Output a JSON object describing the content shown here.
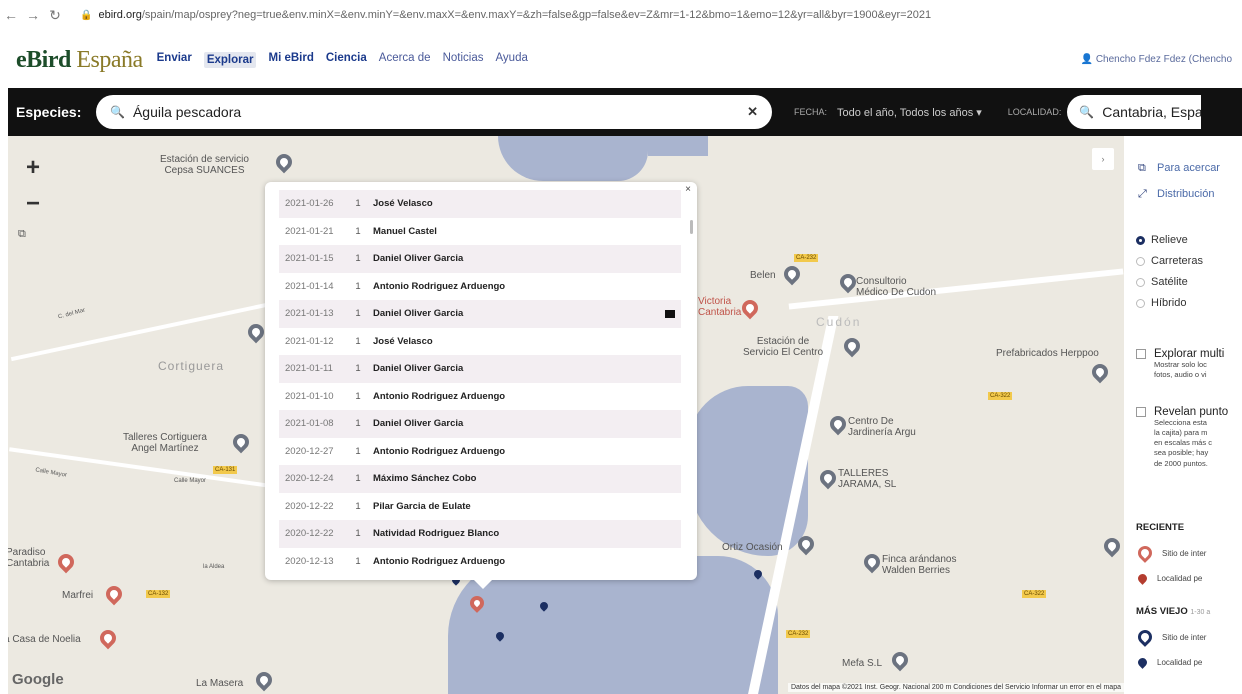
{
  "browser": {
    "url_host": "ebird.org",
    "url_rest": "/spain/map/osprey?neg=true&env.minX=&env.minY=&env.maxX=&env.maxY=&zh=false&gp=false&ev=Z&mr=1-12&bmo=1&emo=12&yr=all&byr=1900&eyr=2021"
  },
  "header": {
    "logo_main": "eBird",
    "logo_region": "España",
    "nav": [
      "Enviar",
      "Explorar",
      "Mi eBird",
      "Ciencia",
      "Acerca de",
      "Noticias",
      "Ayuda"
    ],
    "user": "Chencho Fdez Fdez (Chencho"
  },
  "search": {
    "species_label": "Especies:",
    "species_value": "Águila pescadora",
    "fecha_label": "FECHA:",
    "fecha_value": "Todo el año, Todos los años",
    "locality_label": "LOCALIDAD:",
    "locality_value": "Cantabria, Espa"
  },
  "map": {
    "zoom_in": "+",
    "zoom_out": "−",
    "google": "Google",
    "attribution": "Datos del mapa ©2021 Inst. Geogr. Nacional   200 m   Condiciones del Servicio   Informar un error en el mapa",
    "labels": {
      "cepsa": "Estación de servicio\nCepsa SUANCES",
      "cortiguera": "Cortiguera",
      "talleres_cortiguera": "Talleres Cortiguera\nAngel Martínez",
      "calle_mayor_1": "Calle Mayor",
      "calle_mayor_2": "Calle Mayor",
      "paradiso": "Paradiso\nCantabria",
      "marfrei": "Marfrei",
      "casa_noelia": "a Casa de Noelia",
      "la_masera": "La Masera",
      "belen": "Belen",
      "consultorio": "Consultorio\nMédico De Cudon",
      "victoria": "Victoria\nCantabria",
      "cudon": "Cudón",
      "estacion_centro": "Estación de\nServicio El Centro",
      "prefabricados": "Prefabricados Herppoo",
      "centro_jardineria": "Centro De\nJardinería Argu",
      "talleres_jarama": "TALLERES\nJARAMA, SL",
      "ortiz": "Ortiz Ocasión",
      "finca": "Finca arándanos\nWalden Berries",
      "mefa": "Mefa S.L",
      "c_mar": "C. del Mar",
      "la_aldea": "la Aldea"
    },
    "badges": [
      "CA-232",
      "CA-131",
      "CA-132",
      "CA-322",
      "CA-232",
      "CA-322"
    ]
  },
  "popup": {
    "close": "×",
    "rows": [
      {
        "date": "2021-01-26",
        "count": "1",
        "observer": "José Velasco"
      },
      {
        "date": "2021-01-21",
        "count": "1",
        "observer": "Manuel Castel"
      },
      {
        "date": "2021-01-15",
        "count": "1",
        "observer": "Daniel Oliver Garcia"
      },
      {
        "date": "2021-01-14",
        "count": "1",
        "observer": "Antonio Rodriguez Arduengo"
      },
      {
        "date": "2021-01-13",
        "count": "1",
        "observer": "Daniel Oliver Garcia",
        "media": true
      },
      {
        "date": "2021-01-12",
        "count": "1",
        "observer": "José Velasco"
      },
      {
        "date": "2021-01-11",
        "count": "1",
        "observer": "Daniel Oliver Garcia"
      },
      {
        "date": "2021-01-10",
        "count": "1",
        "observer": "Antonio Rodriguez Arduengo"
      },
      {
        "date": "2021-01-08",
        "count": "1",
        "observer": "Daniel Oliver Garcia"
      },
      {
        "date": "2020-12-27",
        "count": "1",
        "observer": "Antonio Rodriguez Arduengo"
      },
      {
        "date": "2020-12-24",
        "count": "1",
        "observer": "Máximo Sánchez Cobo"
      },
      {
        "date": "2020-12-22",
        "count": "1",
        "observer": "Pilar Garcia de Eulate"
      },
      {
        "date": "2020-12-22",
        "count": "1",
        "observer": "Natividad Rodriguez Blanco"
      },
      {
        "date": "2020-12-13",
        "count": "1",
        "observer": "Antonio Rodriguez Arduengo"
      }
    ]
  },
  "sidebar": {
    "link_zoom": "Para acercar",
    "link_dist": "Distribución",
    "map_types": [
      "Relieve",
      "Carreteras",
      "Satélite",
      "Híbrido"
    ],
    "explore_title": "Explorar multi",
    "explore_desc": [
      "Mostrar solo loc",
      "fotos, audio o vi"
    ],
    "reveal_title": "Revelan punto",
    "reveal_desc": [
      "Selecciona esta",
      "la cajita) para m",
      "en escalas más c",
      "sea posible; hay",
      "de 2000 puntos."
    ],
    "recent": "RECIENTE",
    "older": "MÁS VIEJO",
    "older_range": "1-30 a",
    "legend_site": "Sitio de inter",
    "legend_loc": "Localidad pe",
    "legend_site_old": "Sitio de inter",
    "legend_loc_old": "Localidad pe"
  }
}
